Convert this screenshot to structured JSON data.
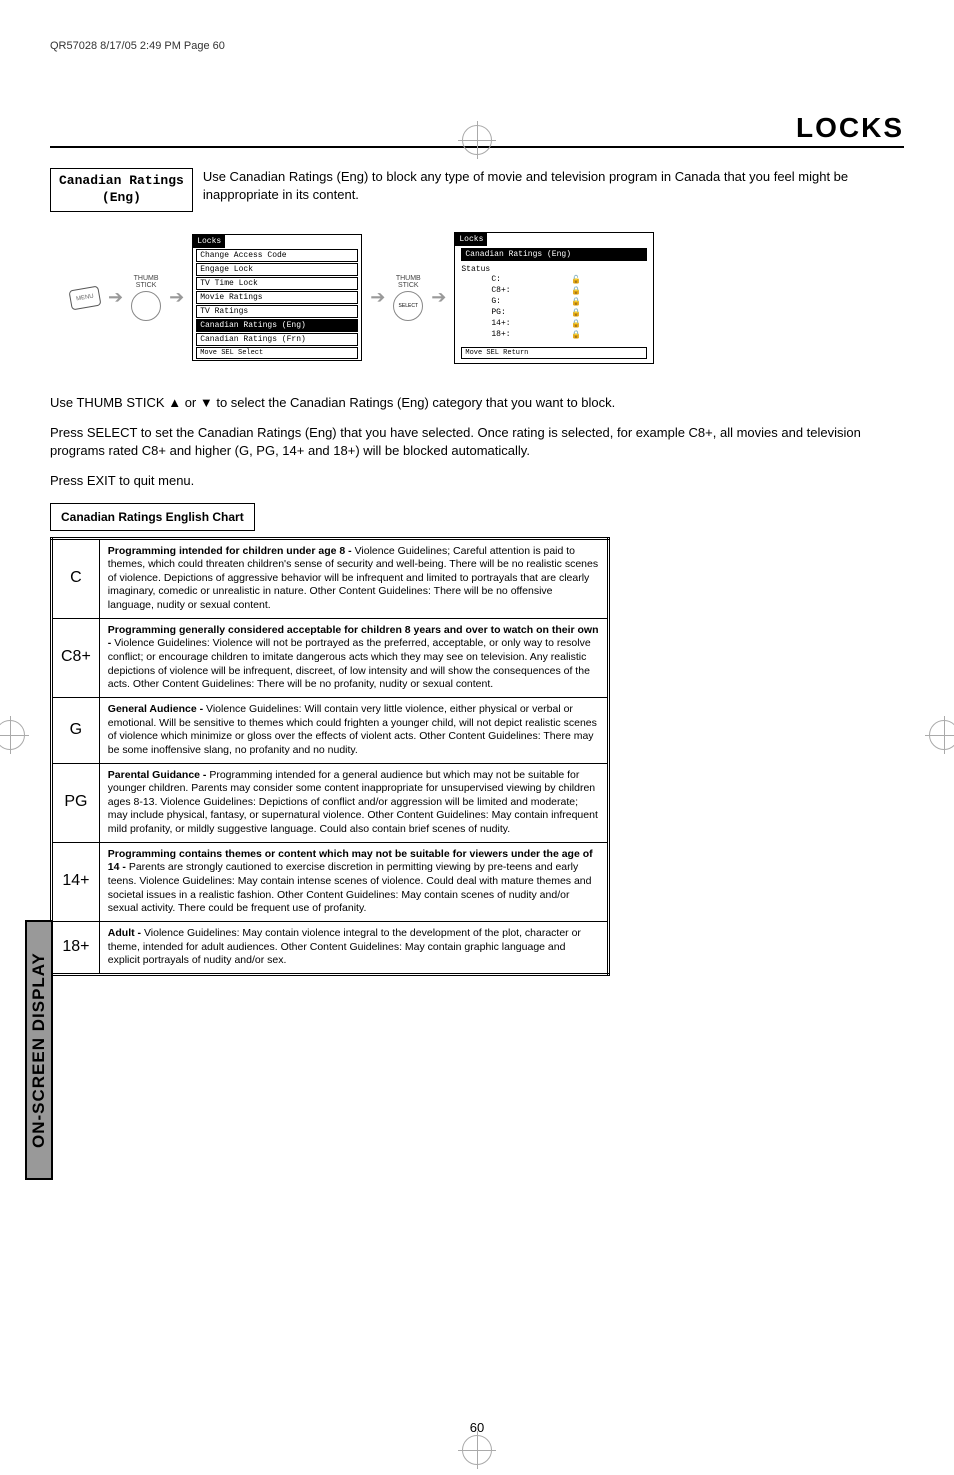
{
  "meta": "QR57028  8/17/05  2:49 PM  Page 60",
  "title": "LOCKS",
  "label": {
    "l1": "Canadian Ratings",
    "l2": "(Eng)"
  },
  "intro": "Use Canadian Ratings (Eng) to block any type of movie and television program in Canada that you feel might be inappropriate in its content.",
  "thumb": "THUMB\nSTICK",
  "menu_btn": "MENU",
  "select_btn": "SELECT",
  "osd1": {
    "header": "Locks",
    "items": [
      "Change Access Code",
      "Engage Lock",
      "TV Time Lock",
      "Movie Ratings",
      "TV Ratings",
      "Canadian Ratings (Eng)",
      "Canadian Ratings (Frn)"
    ],
    "sel_index": 5,
    "footer": "  Move SEL Select"
  },
  "osd2": {
    "header": "Locks",
    "sub": "Canadian Ratings (Eng)",
    "status_label": "Status",
    "rows": [
      {
        "k": "C:",
        "v": "🔓"
      },
      {
        "k": "C8+:",
        "v": "🔒"
      },
      {
        "k": "G:",
        "v": "🔒"
      },
      {
        "k": "PG:",
        "v": "🔒"
      },
      {
        "k": "14+:",
        "v": "🔒"
      },
      {
        "k": "18+:",
        "v": "🔒"
      }
    ],
    "footer": "  Move SEL Return"
  },
  "body1": "Use THUMB STICK ▲ or ▼ to select the Canadian Ratings (Eng) category that you want to block.",
  "body2": "Press SELECT to set the Canadian Ratings (Eng) that you have selected. Once rating is selected, for example C8+, all movies and television programs rated C8+ and higher (G, PG, 14+ and 18+) will be blocked automatically.",
  "body3": "Press EXIT to quit menu.",
  "chart_header": "Canadian Ratings English Chart",
  "chart": [
    {
      "code": "C",
      "bold": "Programming intended for children under age 8 - ",
      "text": "Violence Guidelines; Careful attention is paid to themes, which could threaten children's sense of security and well-being.  There will be no realistic scenes of violence.  Depictions of aggressive behavior will be infrequent and limited to portrayals that are clearly imaginary, comedic or unrealistic in nature.  Other Content Guidelines:  There will be no offensive language, nudity or sexual content."
    },
    {
      "code": "C8+",
      "bold": "Programming generally considered acceptable for children 8 years and over to watch on their own -  ",
      "text": "Violence Guidelines: Violence will not be portrayed as the preferred, acceptable, or only way to resolve conflict; or encourage children to imitate dangerous acts which they may see on television.  Any realistic depictions of violence will be infrequent, discreet, of low intensity and will show the consequences of the acts.  Other Content Guidelines: There will be no profanity, nudity or sexual content."
    },
    {
      "code": "G",
      "bold": "General Audience - ",
      "text": "Violence Guidelines: Will contain very little violence, either physical or verbal or emotional.  Will be sensitive to themes which could frighten a younger child, will not depict realistic scenes of violence which minimize or gloss over the effects of violent acts.  Other Content Guidelines: There may be some inoffensive slang, no profanity and no nudity."
    },
    {
      "code": "PG",
      "bold": "Parental Guidance -  ",
      "text": "Programming intended for a general audience but which may not be suitable for younger children.  Parents may consider some content inappropriate for unsupervised viewing by children ages 8-13.  Violence Guidelines: Depictions of conflict and/or aggression will be limited and moderate; may include physical, fantasy, or supernatural violence.  Other Content Guidelines:  May contain infrequent mild profanity, or mildly suggestive language.  Could also contain brief scenes of nudity."
    },
    {
      "code": "14+",
      "bold": "Programming contains themes or content which may not be suitable for viewers under the age of 14 -  ",
      "text": "Parents are strongly cautioned to exercise discretion in permitting viewing by pre-teens and early teens.  Violence Guidelines: May contain intense scenes of violence.  Could deal with mature themes and societal issues in a realistic fashion.  Other Content Guidelines: May contain scenes of nudity and/or sexual activity.  There could be frequent use of profanity."
    },
    {
      "code": "18+",
      "bold": "Adult - ",
      "text": "Violence Guidelines: May contain violence integral to the development of the plot, character or theme, intended for adult audiences.  Other Content Guidelines: May contain graphic language and explicit portrayals of nudity and/or sex."
    }
  ],
  "side_tab": "ON-SCREEN DISPLAY",
  "page_num": "60"
}
